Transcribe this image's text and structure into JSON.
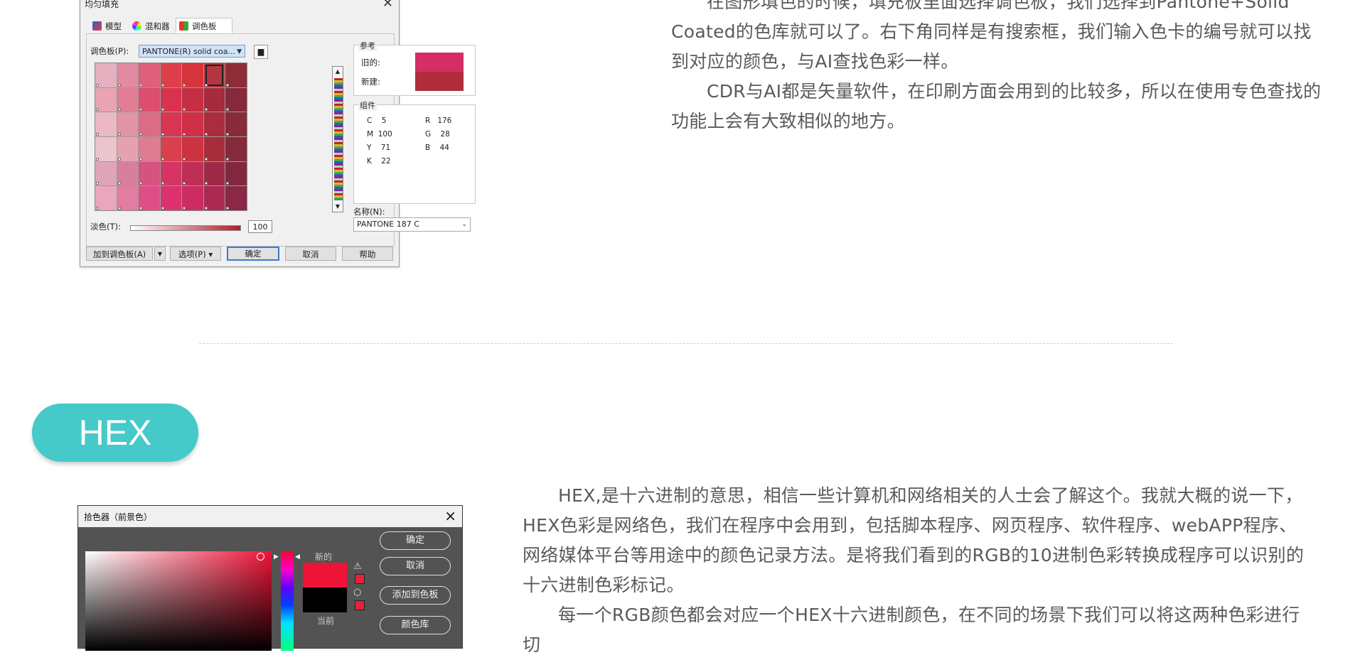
{
  "article": {
    "top_paragraphs": [
      "在图形填色的时候，填充板里面选择调色板，我们选择到Pantone+Solid  Coated的色库就可以了。右下角同样是有搜索框，我们输入色卡的编号就可以找到对应的颜色，与AI查找色彩一样。",
      "CDR与AI都是矢量软件，在印刷方面会用到的比较多，所以在使用专色查找的功能上会有大致相似的地方。"
    ],
    "section_badge": "HEX",
    "hex_paragraphs": [
      "HEX,是十六进制的意思，相信一些计算机和网络相关的人士会了解这个。我就大概的说一下，HEX色彩是网络色，我们在程序中会用到，包括脚本程序、网页程序、软件程序、webAPP程序、网络媒体平台等用途中的颜色记录方法。是将我们看到的RGB的10进制色彩转换成程序可以识别的十六进制色彩标记。",
      "每一个RGB颜色都会对应一个HEX十六进制颜色，在不同的场景下我们可以将这两种色彩进行切"
    ]
  },
  "cdr_dialog": {
    "title": "均匀填充",
    "tabs": [
      "模型",
      "混和器",
      "调色板"
    ],
    "active_tab": 2,
    "palette_label": "调色板(P):",
    "palette_value": "PANTONE(R) solid coa...",
    "reference_label": "参考",
    "old_label": "旧的:",
    "new_label": "新建:",
    "old_color": "#d62d64",
    "new_color": "#b02c38",
    "components_label": "组件",
    "cmyk": [
      [
        "C",
        "5"
      ],
      [
        "M",
        "100"
      ],
      [
        "Y",
        "71"
      ],
      [
        "K",
        "22"
      ]
    ],
    "rgb": [
      [
        "R",
        "176"
      ],
      [
        "G",
        "28"
      ],
      [
        "B",
        "44"
      ]
    ],
    "name_label": "名称(N):",
    "name_value": "PANTONE 187 C",
    "tint_label": "淡色(T):",
    "tint_value": "100",
    "buttons": {
      "add": "加到调色板(A)",
      "options": "选项(P)",
      "ok": "确定",
      "cancel": "取消",
      "help": "帮助"
    },
    "swatches": [
      "#e7b0c0",
      "#e28aa0",
      "#e05f7a",
      "#de3f4a",
      "#d6343a",
      "#b53640",
      "#8e2c38",
      "#e9a4b4",
      "#e17d95",
      "#dd4d6d",
      "#d9324f",
      "#c42f44",
      "#a52b3e",
      "#86293a",
      "#ebb8c4",
      "#e293a6",
      "#dc6b86",
      "#d93552",
      "#cf3045",
      "#ab2c3c",
      "#8a2a38",
      "#ecc4cc",
      "#e4a2b0",
      "#dd7c92",
      "#da3f4d",
      "#cb3341",
      "#a82d3c",
      "#86293a",
      "#e0a4b8",
      "#d97f9e",
      "#d5537e",
      "#d53464",
      "#bf2f54",
      "#9f2a48",
      "#82283e",
      "#eaa6be",
      "#e47ba0",
      "#df4f86",
      "#dc3270",
      "#cd2c62",
      "#ac2a52",
      "#8a2846"
    ]
  },
  "ps_dialog": {
    "title": "拾色器（前景色）",
    "new_label": "新的",
    "current_label": "当前",
    "new_color": "#ee1437",
    "current_color": "#000000",
    "buttons": [
      "确定",
      "取消",
      "添加到色板",
      "颜色库"
    ]
  }
}
